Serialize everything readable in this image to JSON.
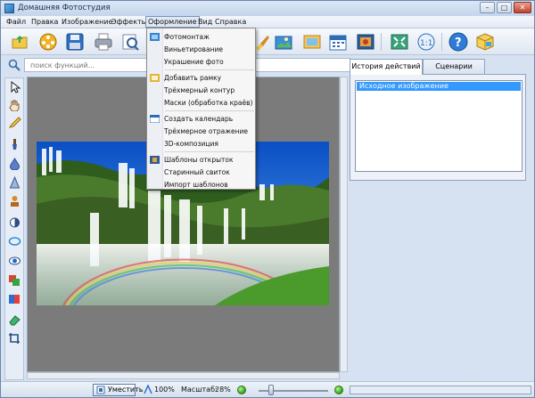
{
  "window": {
    "title": "Домашняя Фотостудия",
    "controls": {
      "minimize": "–",
      "maximize": "□",
      "close": "✕"
    }
  },
  "menubar": {
    "items": [
      "Файл",
      "Правка",
      "Изображение",
      "Эффекты",
      "Оформление",
      "Вид",
      "Справка"
    ],
    "open_menu": "Оформление"
  },
  "dropdown": {
    "groups": [
      [
        "Фотомонтаж",
        "Виньетирование",
        "Украшение фото"
      ],
      [
        "Добавить рамку",
        "Трёхмерный контур",
        "Маски (обработка краёв)"
      ],
      [
        "Создать календарь",
        "Трёхмерное отражение",
        "3D-композиция"
      ],
      [
        "Шаблоны открыток",
        "Старинный свиток",
        "Импорт шаблонов"
      ]
    ]
  },
  "search": {
    "placeholder": "поиск функций..."
  },
  "right_panel": {
    "tabs": [
      "История действий",
      "Сценарии"
    ],
    "active_tab": "История действий",
    "history_items": [
      "Исходное изображение"
    ]
  },
  "status": {
    "fit_label": "Уместить",
    "zoom_100": "100%",
    "scale_label": "Масштаб:",
    "scale_value": "28%"
  },
  "colors": {
    "accent": "#3399ff",
    "window_bg": "#d6e2f1",
    "canvas_bg": "#7b7b7b"
  }
}
